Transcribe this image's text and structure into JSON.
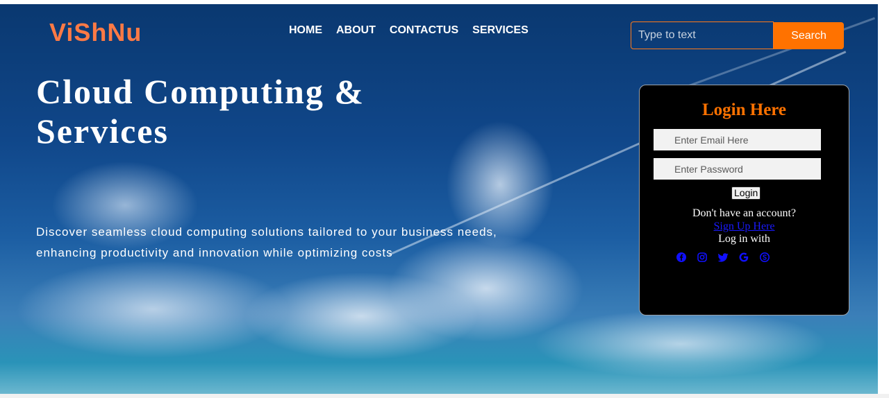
{
  "header": {
    "logo": "ViShNu",
    "nav": [
      "HOME",
      "ABOUT",
      "CONTACTUS",
      "SERVICES"
    ],
    "search": {
      "placeholder": "Type to text",
      "button_label": "Search"
    }
  },
  "hero": {
    "title": "Cloud Computing & Services",
    "description": "Discover seamless cloud computing solutions tailored to your business needs, enhancing productivity and innovation while optimizing costs"
  },
  "login": {
    "title": "Login Here",
    "email_placeholder": "Enter Email Here",
    "password_placeholder": "Enter Password",
    "button_label": "Login",
    "no_account": "Don't have an account?",
    "signup_link": "Sign Up Here",
    "log_in_with": "Log in with",
    "social_icons": [
      "facebook-icon",
      "instagram-icon",
      "twitter-icon",
      "google-icon",
      "skype-icon"
    ]
  },
  "colors": {
    "accent": "#ff7200",
    "logo": "#ff7a45",
    "social_icon": "#1010ff"
  }
}
